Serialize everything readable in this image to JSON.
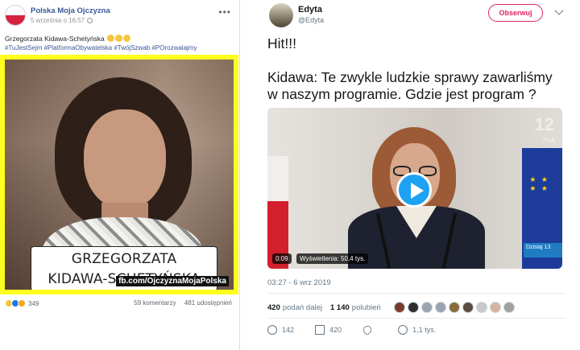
{
  "facebook_post": {
    "page_name": "Polska Moja Ojczyzna",
    "timestamp": "5 września o 16:57",
    "text": "Grzegorzata Kidawa-Schetyńska",
    "hashtags": "#TuJestSejm #PlatformaObywatelska #TwójSzwab #POrozwalajmy",
    "image_caption_line1": "GRZEGORZATA",
    "image_caption_line2": "KIDAWA-SCHETYŃSKA",
    "watermark": "fb.com/OjczyznaMojaPolska",
    "reaction_count": "349",
    "comments": "59 komentarzy",
    "shares": "481 udostępnień",
    "icons": [
      "globe-icon",
      "more-icon",
      "haha-reaction-icon",
      "like-reaction-icon",
      "wow-reaction-icon"
    ],
    "colors": {
      "frame_yellow": "#ffff1f",
      "link_blue": "#385898"
    }
  },
  "tweet": {
    "author_name": "Edyta",
    "author_handle": "@Edyta",
    "follow_label": "Obserwuj",
    "text_line1": "Hit!!!",
    "text_line2": "Kidawa: Te zwykle ludzkie sprawy zawarliśmy",
    "text_line3": "w naszym programie. Gdzie jest program ?",
    "video": {
      "duration": "0:09",
      "views": "Wyświetlenia: 50,4 tys.",
      "channel_logo": "12",
      "channel_sub": "PIĄ",
      "ticker": "Dzisiaj 13"
    },
    "date": "03:27 - 6 wrz 2019",
    "retweets": {
      "count": "420",
      "label": "podań dalej"
    },
    "likes": {
      "count": "1 140",
      "label": "polubień"
    },
    "liker_avatar_colors": [
      "#7a3b2e",
      "#2f2f2f",
      "#9aa5b1",
      "#9aa5b1",
      "#8a6d3b",
      "#5a4b3c",
      "#c9c9c9",
      "#d8b4a0",
      "#a0a0a0"
    ],
    "actions": {
      "reply": "142",
      "retweet": "420",
      "like": "",
      "views": "1,1 tys."
    },
    "colors": {
      "follow": "#e0245e",
      "play": "#1da1f2"
    }
  }
}
